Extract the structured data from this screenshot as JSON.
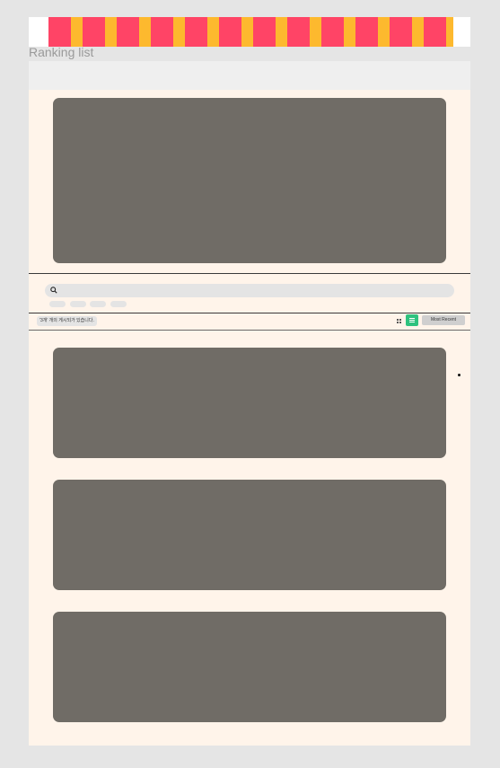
{
  "page": {
    "title": "Ranking list"
  },
  "banner": {
    "colors": [
      "#ff4466",
      "#fdb92e"
    ]
  },
  "search": {
    "icon": "search-icon"
  },
  "results": {
    "count_text": "'3개' 개의 게시되가 있습니다."
  },
  "view": {
    "active": "list",
    "grid_icon": "grid-icon",
    "list_icon": "list-icon"
  },
  "sort": {
    "label": "Most Recent"
  },
  "colors": {
    "background": "#e5e5e5",
    "frame": "#fff4ea",
    "card": "#706c66",
    "accent": "#2ec27e"
  }
}
